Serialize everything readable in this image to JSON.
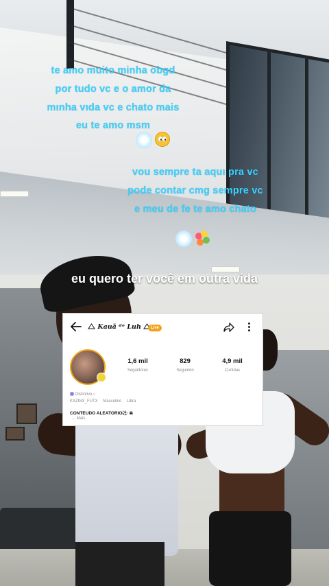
{
  "captions": {
    "block_1": "te amo muito minha obgd\npor tudo vc e o amor da\nmınha vıda vc e chato mais\neu te amo msm",
    "block_2": "vou sempre ta aquı pra vc\npode contar cmg sempre vc\ne meu de fe te amo chato"
  },
  "quote": "eu quero ter você em outra vida",
  "profile": {
    "username": "Kauã ᵈᵉ Luh",
    "live_badge": "Live",
    "stats": [
      {
        "value": "1,6 mil",
        "label": "Seguidores"
      },
      {
        "value": "829",
        "label": "Seguindo"
      },
      {
        "value": "4,9 mil",
        "label": "Curtidas"
      }
    ],
    "badge_text": "Distintivo ›",
    "meta": [
      "KXZINX_FUTX",
      "Masculino",
      "Libra"
    ],
    "bio": "CONTEUDO ALEATORIO⚽ ☠",
    "more_label": "... Mais"
  },
  "icons": {
    "back": "back-arrow-icon",
    "share": "share-icon",
    "more": "more-vertical-icon"
  },
  "colors": {
    "caption": "#39d3ff",
    "avatar_ring": "#f2a517",
    "badge": "#f4a21b"
  }
}
